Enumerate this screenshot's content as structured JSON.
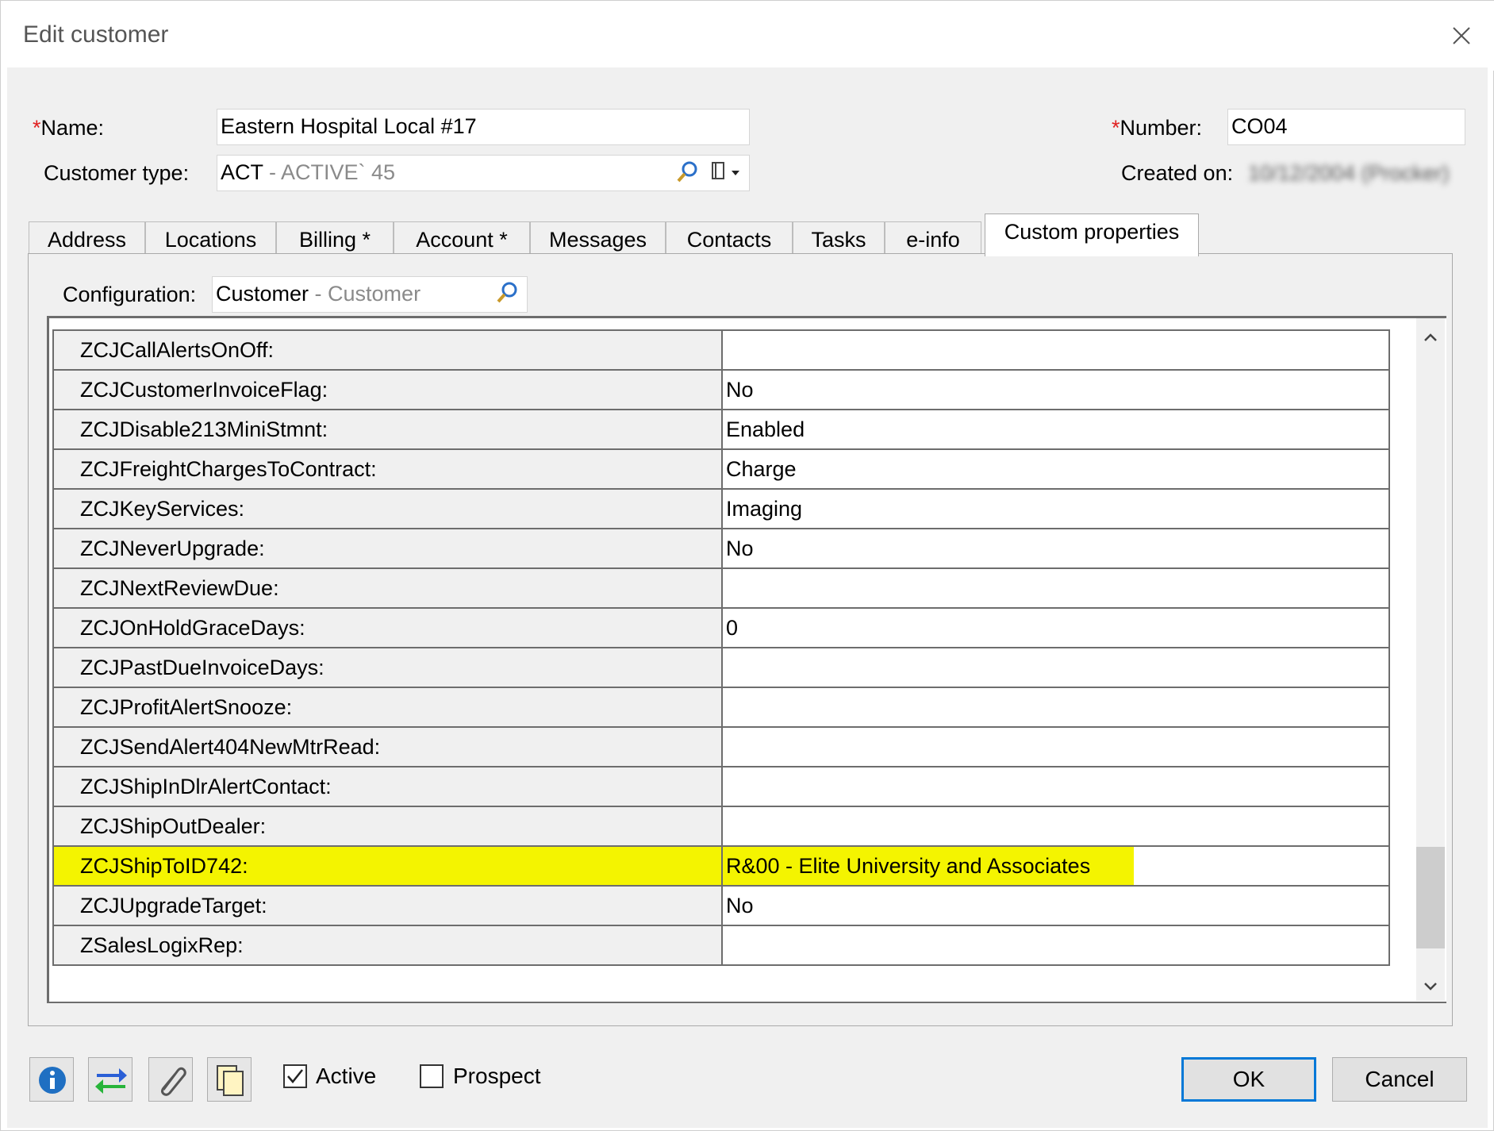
{
  "window": {
    "title": "Edit customer"
  },
  "header": {
    "name_label": "Name:",
    "name_value": "Eastern Hospital Local #17",
    "number_label": "Number:",
    "number_value": "CO04",
    "customer_type_label": "Customer type:",
    "customer_type_code": "ACT",
    "customer_type_desc": " - ACTIVE` 45",
    "created_on_label": "Created on:",
    "created_on_value": "10/12/2004 (Procker)"
  },
  "tabs": [
    {
      "label": "Address"
    },
    {
      "label": "Locations"
    },
    {
      "label": "Billing  *"
    },
    {
      "label": "Account *"
    },
    {
      "label": "Messages"
    },
    {
      "label": "Contacts"
    },
    {
      "label": "Tasks"
    },
    {
      "label": "e-info"
    },
    {
      "label": "Custom properties",
      "active": true
    }
  ],
  "configuration": {
    "label": "Configuration:",
    "code": "Customer",
    "desc": " - Customer"
  },
  "properties": [
    {
      "key": "ZCJCallAlertsOnOff:",
      "value": ""
    },
    {
      "key": "ZCJCustomerInvoiceFlag:",
      "value": "No"
    },
    {
      "key": "ZCJDisable213MiniStmnt:",
      "value": "Enabled"
    },
    {
      "key": "ZCJFreightChargesToContract:",
      "value": "Charge"
    },
    {
      "key": "ZCJKeyServices:",
      "value": "Imaging"
    },
    {
      "key": "ZCJNeverUpgrade:",
      "value": "No"
    },
    {
      "key": "ZCJNextReviewDue:",
      "value": ""
    },
    {
      "key": "ZCJOnHoldGraceDays:",
      "value": "0"
    },
    {
      "key": "ZCJPastDueInvoiceDays:",
      "value": ""
    },
    {
      "key": "ZCJProfitAlertSnooze:",
      "value": ""
    },
    {
      "key": "ZCJSendAlert404NewMtrRead:",
      "value": ""
    },
    {
      "key": "ZCJShipInDlrAlertContact:",
      "value": ""
    },
    {
      "key": "ZCJShipOutDealer:",
      "value": ""
    },
    {
      "key": "ZCJShipToID742:",
      "value": "R&00 - Elite University and Associates",
      "highlighted": true
    },
    {
      "key": "ZCJUpgradeTarget:",
      "value": "No"
    },
    {
      "key": "ZSalesLogixRep:",
      "value": ""
    }
  ],
  "footer": {
    "toolbar_icons": [
      "info-icon",
      "transfer-arrows-icon",
      "attachment-icon",
      "copy-documents-icon"
    ],
    "active_label": "Active",
    "active_checked": true,
    "prospect_label": "Prospect",
    "prospect_checked": false,
    "ok_label": "OK",
    "cancel_label": "Cancel"
  },
  "colors": {
    "highlight": "#f4f400",
    "required_marker": "#e02020",
    "dialog_bg": "#f0f0f0",
    "default_button_border": "#0078d7"
  }
}
